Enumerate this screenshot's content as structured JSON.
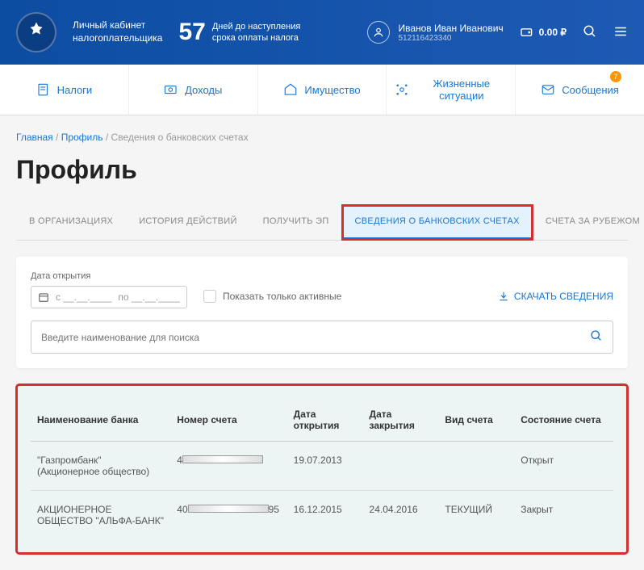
{
  "header": {
    "brand_line1": "Личный кабинет",
    "brand_line2": "налогоплательщика",
    "days_count": "57",
    "days_text1": "Дней до наступления",
    "days_text2": "срока оплаты налога",
    "user_name": "Иванов Иван Иванович",
    "user_id": "512116423340",
    "balance": "0.00 ₽"
  },
  "nav": {
    "items": [
      {
        "label": "Налоги"
      },
      {
        "label": "Доходы"
      },
      {
        "label": "Имущество"
      },
      {
        "label": "Жизненные ситуации"
      },
      {
        "label": "Сообщения",
        "badge": "7"
      }
    ]
  },
  "breadcrumb": {
    "home": "Главная",
    "profile": "Профиль",
    "current": "Сведения о банковских счетах"
  },
  "page_title": "Профиль",
  "tabs": [
    {
      "label": "В ОРГАНИЗАЦИЯХ"
    },
    {
      "label": "ИСТОРИЯ ДЕЙСТВИЙ"
    },
    {
      "label": "ПОЛУЧИТЬ ЭП"
    },
    {
      "label": "СВЕДЕНИЯ О БАНКОВСКИХ СЧЕТАХ",
      "active": true
    },
    {
      "label": "СЧЕТА ЗА РУБЕЖОМ"
    }
  ],
  "filters": {
    "date_label": "Дата открытия",
    "date_from": "с __.__.____",
    "date_to": "по __.__.____",
    "active_only": "Показать только активные",
    "download": "СКАЧАТЬ СВЕДЕНИЯ",
    "search_placeholder": "Введите наименование для поиска"
  },
  "table": {
    "headers": {
      "bank": "Наименование банка",
      "account": "Номер счета",
      "opened": "Дата открытия",
      "closed": "Дата закрытия",
      "type": "Вид счета",
      "status": "Состояние счета"
    },
    "rows": [
      {
        "bank": "\"Газпромбанк\" (Акционерное общество)",
        "account_prefix": "4",
        "account_suffix": "",
        "opened": "19.07.2013",
        "closed": "",
        "type": "",
        "status": "Открыт"
      },
      {
        "bank": "АКЦИОНЕРНОЕ ОБЩЕСТВО \"АЛЬФА-БАНК\"",
        "account_prefix": "40",
        "account_suffix": "95",
        "opened": "16.12.2015",
        "closed": "24.04.2016",
        "type": "ТЕКУЩИЙ",
        "status": "Закрыт"
      }
    ]
  }
}
